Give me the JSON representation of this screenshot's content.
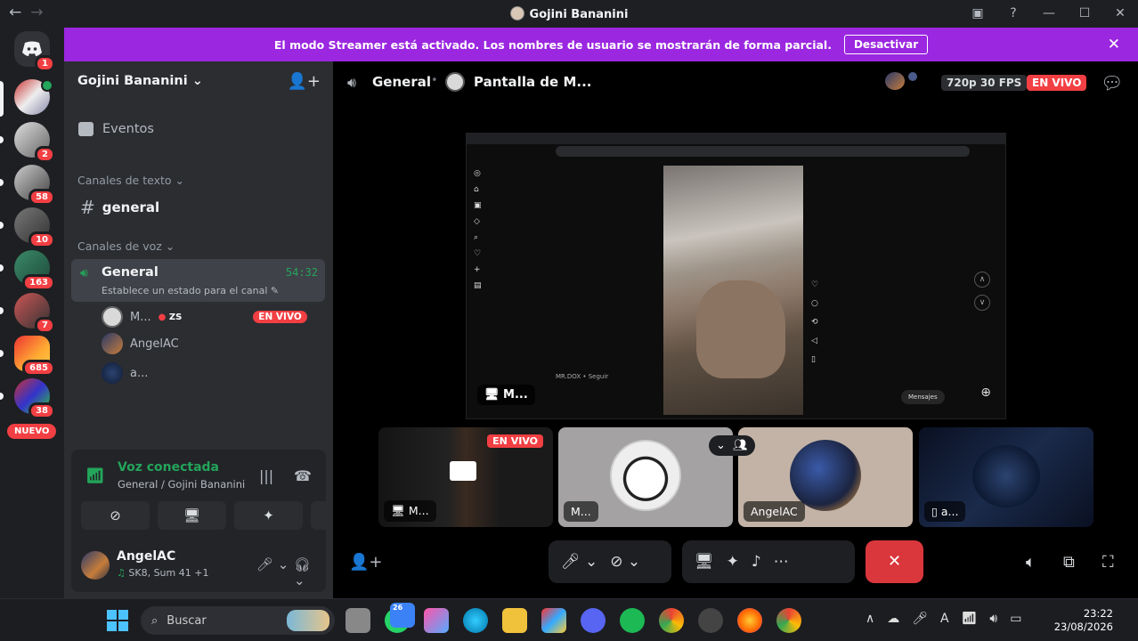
{
  "titlebar": {
    "title": "Gojini Bananini",
    "back": "←",
    "forward": "→",
    "minimize": "—",
    "maximize": "☐",
    "close": "✕"
  },
  "banner": {
    "text": "El modo Streamer está activado. Los nombres de usuario se mostrarán de forma parcial.",
    "button": "Desactivar"
  },
  "rail": {
    "badges": [
      "1",
      "2",
      "58",
      "10",
      "163",
      "7",
      "685",
      "38"
    ],
    "nuevo": "NUEVO"
  },
  "sidebar": {
    "server_name": "Gojini Bananini",
    "events": "Eventos",
    "text_category": "Canales de texto",
    "text_channel": "general",
    "voice_category": "Canales de voz",
    "voice_channel": {
      "name": "General",
      "timer": "54:32",
      "status": "Establece un estado para el canal"
    },
    "voice_users": [
      {
        "name": "M...",
        "extra": "ZS",
        "live": "EN VIVO"
      },
      {
        "name": "AngelAC"
      },
      {
        "name": "a..."
      }
    ],
    "voice_panel": {
      "status": "Voz conectada",
      "location": "General / Gojini Bananini"
    },
    "user": {
      "name": "AngelAC",
      "activity": "SK8, Sum 41 +1"
    }
  },
  "stage": {
    "channel": "General",
    "share_title": "Pantalla de M...",
    "quality": "720p 30 FPS",
    "live": "EN VIVO",
    "screen_tag": "M...",
    "instagram": {
      "caption_user": "MR.DOX • Seguir",
      "message_button": "Mensajes"
    },
    "tiles": [
      {
        "name": "M...",
        "live": "EN VIVO"
      },
      {
        "name": "M..."
      },
      {
        "name": "AngelAC"
      },
      {
        "name": "a..."
      }
    ]
  },
  "taskbar": {
    "search": "Buscar",
    "time": "23:22",
    "date": "23/08/2026",
    "whatsapp_badge": "26"
  },
  "colors": {
    "banner": "#9b27e0",
    "green": "#23a55a",
    "red": "#f23f43",
    "hangup": "#da373c"
  }
}
